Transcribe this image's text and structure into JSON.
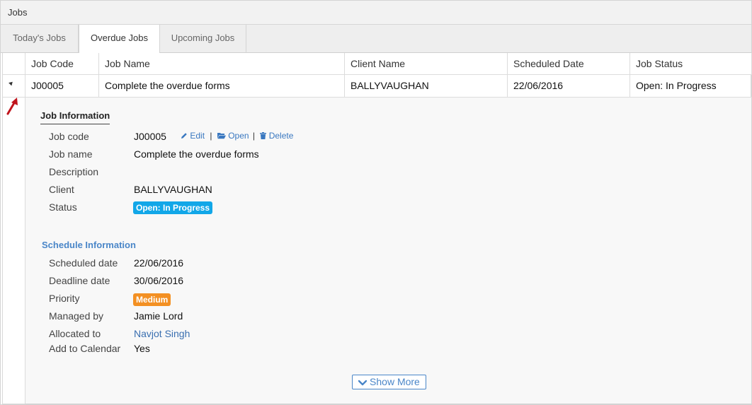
{
  "panel": {
    "title": "Jobs"
  },
  "tabs": [
    {
      "label": "Today's Jobs"
    },
    {
      "label": "Overdue Jobs",
      "active": true
    },
    {
      "label": "Upcoming Jobs"
    }
  ],
  "grid": {
    "columns": [
      "Job Code",
      "Job Name",
      "Client Name",
      "Scheduled Date",
      "Job Status"
    ],
    "rows": [
      [
        "J00005",
        "Complete the overdue forms",
        "BALLYVAUGHAN",
        "22/06/2016",
        "Open: In Progress"
      ]
    ]
  },
  "detail": {
    "job_info_title": "Job Information",
    "job_code_label": "Job code",
    "job_code": "J00005",
    "actions": {
      "edit": "Edit",
      "open": "Open",
      "delete": "Delete"
    },
    "job_name_label": "Job name",
    "job_name": "Complete the overdue forms",
    "description_label": "Description",
    "client_label": "Client",
    "client": "BALLYVAUGHAN",
    "status_label": "Status",
    "status": "Open: In Progress",
    "schedule_title": "Schedule Information",
    "scheduled_date_label": "Scheduled date",
    "scheduled_date": "22/06/2016",
    "deadline_date_label": "Deadline date",
    "deadline_date": "30/06/2016",
    "priority_label": "Priority",
    "priority": "Medium",
    "managed_by_label": "Managed by",
    "managed_by": "Jamie Lord",
    "allocated_to_label": "Allocated to",
    "allocated_to": "Navjot Singh",
    "add_to_calendar_label": "Add to Calendar",
    "add_to_calendar": "Yes",
    "show_more": "Show More"
  },
  "colors": {
    "status_badge": "#12a7e8",
    "priority_badge": "#f39023",
    "link": "#3a78c0",
    "annotation_arrow": "#c0141c"
  },
  "icons": [
    "pencil-icon",
    "folder-open-icon",
    "trash-icon",
    "chevron-down-icon",
    "expand-triangle-icon",
    "annotation-arrow-icon"
  ]
}
